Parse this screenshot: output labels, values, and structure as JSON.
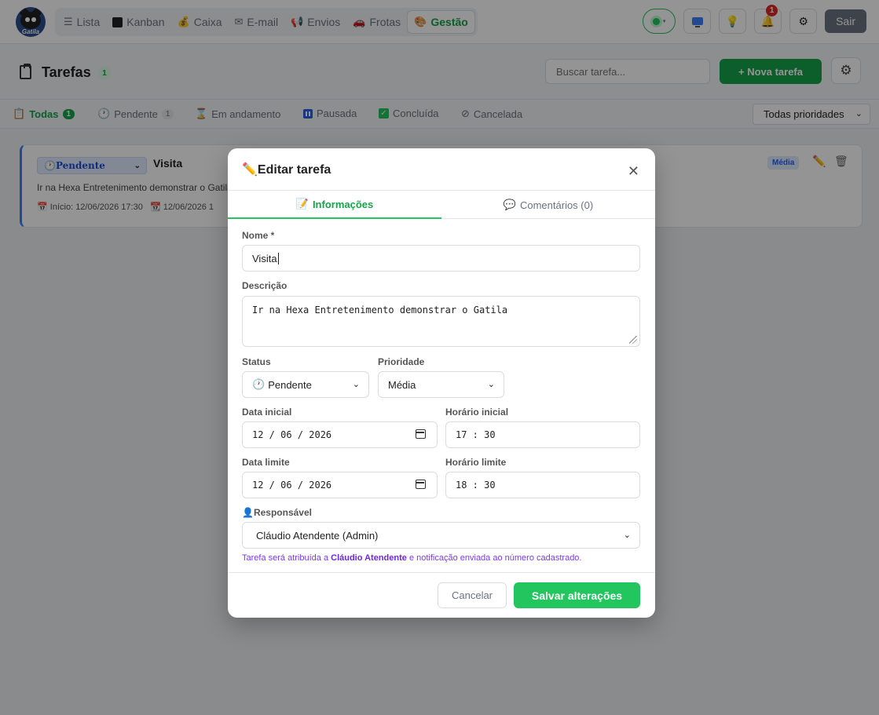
{
  "nav": {
    "tabs": [
      {
        "label": "Lista",
        "icon": "list-icon"
      },
      {
        "label": "Kanban",
        "icon": "kanban-icon"
      },
      {
        "label": "Caixa",
        "icon": "money-bag-icon"
      },
      {
        "label": "E-mail",
        "icon": "envelope-icon"
      },
      {
        "label": "Envios",
        "icon": "megaphone-icon"
      },
      {
        "label": "Frotas",
        "icon": "car-icon"
      },
      {
        "label": "Gestão",
        "icon": "palette-icon"
      }
    ],
    "active_tab": "Gestão",
    "logo_text": "Gatila",
    "notification_count": "1",
    "logout_label": "Sair"
  },
  "header": {
    "title": "Tarefas",
    "count": "1",
    "search_placeholder": "Buscar tarefa...",
    "new_task_label": "+ Nova tarefa"
  },
  "filters": {
    "tabs": [
      {
        "label": "Todas",
        "count": "1",
        "icon": "clipboard-icon"
      },
      {
        "label": "Pendente",
        "count": "1",
        "icon": "clock-icon"
      },
      {
        "label": "Em andamento",
        "icon": "hourglass-icon"
      },
      {
        "label": "Pausada",
        "icon": "pause-icon"
      },
      {
        "label": "Concluída",
        "icon": "check-icon"
      },
      {
        "label": "Cancelada",
        "icon": "prohibited-icon"
      }
    ],
    "priority_select": "Todas prioridades"
  },
  "task": {
    "status": "Pendente",
    "name": "Visita",
    "description": "Ir na Hexa Entretenimento demonstrar o Gatila",
    "start_prefix": "Início:",
    "start": "12/06/2026 17:30",
    "end_date": "12/06/2026 1",
    "priority": "Média"
  },
  "modal": {
    "title": "Editar tarefa",
    "tab_info": "Informações",
    "tab_comments": "Comentários (0)",
    "name_label": "Nome *",
    "name_value": "Visita",
    "desc_label": "Descrição",
    "desc_value": "Ir na Hexa Entretenimento demonstrar o Gatila",
    "status_label": "Status",
    "status_value": "Pendente",
    "priority_label": "Prioridade",
    "priority_value": "Média",
    "start_date_label": "Data inicial",
    "start_date_value": "12 / 06 / 2026",
    "start_time_label": "Horário inicial",
    "start_time_value": "17 : 30",
    "end_date_label": "Data limite",
    "end_date_value": "12 / 06 / 2026",
    "end_time_label": "Horário limite",
    "end_time_value": "18 : 30",
    "responsible_label": "Responsável",
    "responsible_value": "Cláudio Atendente (Admin)",
    "note_prefix": "Tarefa será atribuída a ",
    "note_name": "Cláudio Atendente",
    "note_suffix": " e notificação enviada ao número cadastrado.",
    "cancel_label": "Cancelar",
    "save_label": "Salvar alterações"
  },
  "colors": {
    "accent": "#16a34a",
    "accent_light": "#22c55e",
    "status_blue": "#3b82f6",
    "note_purple": "#7c3aed"
  }
}
